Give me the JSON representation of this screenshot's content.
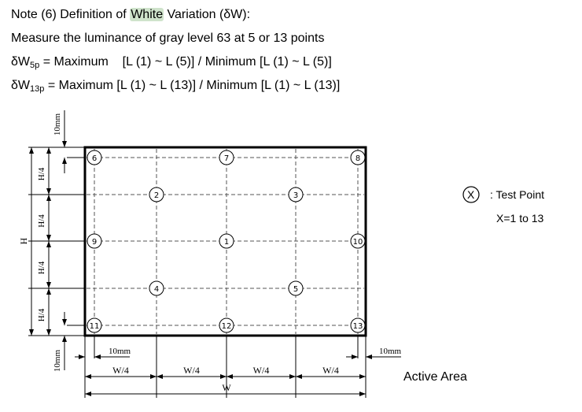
{
  "note": {
    "prefix": "Note (6) Definition of ",
    "highlight": "White",
    "suffix": " Variation (δW):",
    "highlight_color": "#cfe3cb"
  },
  "measure_text": "Measure the luminance of gray level 63 at 5 or 13 points",
  "formula_5p": {
    "symbol": "δW",
    "subscript": "5p",
    "expression": " = Maximum    [L (1) ~ L (5)] / Minimum [L (1) ~ L (5)]"
  },
  "formula_13p": {
    "symbol": "δW",
    "subscript": "13p",
    "expression": " = Maximum [L (1) ~ L (13)] / Minimum [L (1) ~ L (13)]"
  },
  "diagram": {
    "points": [
      {
        "label": "6",
        "col": 0,
        "row": 0
      },
      {
        "label": "7",
        "col": 2,
        "row": 0
      },
      {
        "label": "8",
        "col": 4,
        "row": 0
      },
      {
        "label": "2",
        "col": 1,
        "row": 1
      },
      {
        "label": "3",
        "col": 3,
        "row": 1
      },
      {
        "label": "9",
        "col": 0,
        "row": 2
      },
      {
        "label": "1",
        "col": 2,
        "row": 2
      },
      {
        "label": "10",
        "col": 4,
        "row": 2
      },
      {
        "label": "4",
        "col": 1,
        "row": 3
      },
      {
        "label": "5",
        "col": 3,
        "row": 3
      },
      {
        "label": "11",
        "col": 0,
        "row": 4
      },
      {
        "label": "12",
        "col": 2,
        "row": 4
      },
      {
        "label": "13",
        "col": 4,
        "row": 4
      }
    ],
    "dim_labels": {
      "h_quarter": "H/4",
      "h_total": "H",
      "w_quarter": "W/4",
      "w_total": "W",
      "margin": "10mm"
    }
  },
  "legend": {
    "symbol": "X",
    "label": ": Test Point",
    "range": "X=1 to 13"
  },
  "active_area_label": "Active Area"
}
